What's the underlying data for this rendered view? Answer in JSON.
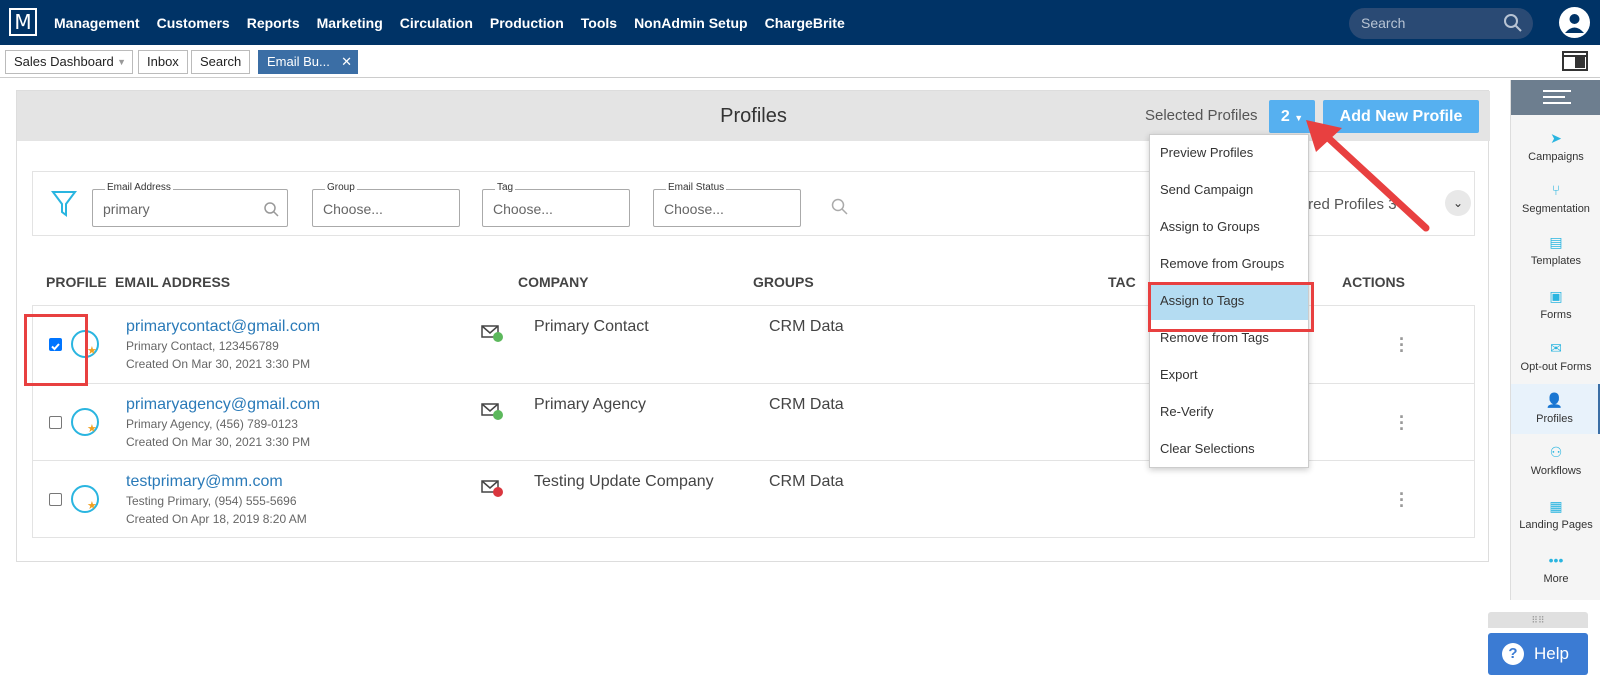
{
  "topnav": {
    "logo": "M",
    "menu": [
      "Management",
      "Customers",
      "Reports",
      "Marketing",
      "Circulation",
      "Production",
      "Tools",
      "NonAdmin Setup",
      "ChargeBrite"
    ],
    "search_placeholder": "Search"
  },
  "tabs": [
    {
      "label": "Sales Dashboard"
    },
    {
      "label": "Inbox"
    },
    {
      "label": "Search"
    },
    {
      "label": "Email Bu..."
    }
  ],
  "header": {
    "title": "Profiles",
    "selected_label": "Selected Profiles",
    "selected_count": "2",
    "add_button": "Add New Profile"
  },
  "filters": {
    "email": {
      "label": "Email Address",
      "value": "primary"
    },
    "group": {
      "label": "Group",
      "placeholder": "Choose..."
    },
    "tag": {
      "label": "Tag",
      "placeholder": "Choose..."
    },
    "status": {
      "label": "Email Status",
      "placeholder": "Choose..."
    },
    "filtered_label": "iltered Profiles  3"
  },
  "columns": [
    "PROFILE",
    "EMAIL ADDRESS",
    "COMPANY",
    "GROUPS",
    "TAC",
    "ACTIONS"
  ],
  "rows": [
    {
      "email": "primarycontact@gmail.com",
      "sub1": "Primary Contact,  123456789",
      "sub2": "Created On Mar 30, 2021 3:30 PM",
      "company": "Primary Contact",
      "groups": "CRM Data",
      "checked": true,
      "status": "verified"
    },
    {
      "email": "primaryagency@gmail.com",
      "sub1": "Primary Agency,  (456) 789-0123",
      "sub2": "Created On Mar 30, 2021 3:30 PM",
      "company": "Primary Agency",
      "groups": "CRM Data",
      "checked": false,
      "status": "verified"
    },
    {
      "email": "testprimary@mm.com",
      "sub1": "Testing Primary,  (954) 555-5696",
      "sub2": "Created On Apr 18, 2019 8:20 AM",
      "company": "Testing Update Company",
      "groups": "CRM Data",
      "checked": false,
      "status": "invalid"
    }
  ],
  "dropdown": [
    "Preview Profiles",
    "Send Campaign",
    "Assign to Groups",
    "Remove from Groups",
    "Assign to Tags",
    "Remove from Tags",
    "Export",
    "Re-Verify",
    "Clear Selections"
  ],
  "dropdown_highlighted": "Assign to Tags",
  "sidebar": [
    "Campaigns",
    "Segmentation",
    "Templates",
    "Forms",
    "Opt-out Forms",
    "Profiles",
    "Workflows",
    "Landing Pages",
    "More"
  ],
  "sidebar_active": "Profiles",
  "help": "Help"
}
